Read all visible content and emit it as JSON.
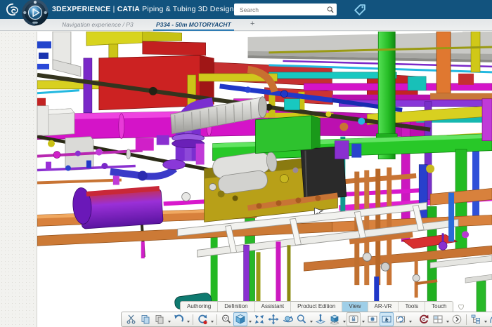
{
  "header": {
    "brand": "3DEXPERIENCE",
    "divider": "|",
    "app_name": "CATIA",
    "app_suffix": "Piping & Tubing 3D Design",
    "search_placeholder": "Search"
  },
  "nav": {
    "breadcrumb": "Navigation experience / P3",
    "active_document_tab": "P334 - 50m MOTORYACHT",
    "new_tab_label": "+"
  },
  "action_bar": {
    "tabs": [
      {
        "name": "authoring",
        "label": "Authoring",
        "active": false
      },
      {
        "name": "definition",
        "label": "Definition",
        "active": false
      },
      {
        "name": "assistant",
        "label": "Assistant",
        "active": false
      },
      {
        "name": "product-edition",
        "label": "Product Edition",
        "active": false
      },
      {
        "name": "view",
        "label": "View",
        "active": true
      },
      {
        "name": "ar-vr",
        "label": "AR-VR",
        "active": false
      },
      {
        "name": "tools",
        "label": "Tools",
        "active": false
      },
      {
        "name": "touch",
        "label": "Touch",
        "active": false
      }
    ]
  },
  "toolbar": {
    "icons": [
      {
        "name": "cut",
        "icon": "cut",
        "dropdown": false
      },
      {
        "name": "copy",
        "icon": "copy",
        "dropdown": false
      },
      {
        "name": "paste",
        "icon": "paste",
        "dropdown": true
      },
      {
        "name": "undo",
        "icon": "undo",
        "dropdown": true
      },
      {
        "name": "update",
        "icon": "update",
        "dropdown": true,
        "sep_before": true
      },
      {
        "name": "look-at",
        "icon": "lookat",
        "dropdown": false,
        "sep_before": true
      },
      {
        "name": "iso-view",
        "icon": "cube",
        "dropdown": true,
        "active": true
      },
      {
        "name": "fit-all-in",
        "icon": "fit",
        "dropdown": false
      },
      {
        "name": "pan",
        "icon": "pan",
        "dropdown": false
      },
      {
        "name": "rotate",
        "icon": "rotate",
        "dropdown": false
      },
      {
        "name": "zoom",
        "icon": "zoom",
        "dropdown": true
      },
      {
        "name": "normal-view",
        "icon": "normalto",
        "dropdown": false
      },
      {
        "name": "named-views",
        "icon": "views",
        "dropdown": true
      },
      {
        "name": "screen-lock",
        "icon": "screenlock",
        "dropdown": true,
        "boxed": true
      },
      {
        "name": "screen-settings",
        "icon": "screengear",
        "dropdown": false
      },
      {
        "name": "screen-select",
        "icon": "screencursor",
        "dropdown": false,
        "active": true
      },
      {
        "name": "screen-rotate",
        "icon": "screenrotate",
        "dropdown": true
      },
      {
        "name": "update-visualization",
        "icon": "refreshred",
        "dropdown": false,
        "gap_before": true
      },
      {
        "name": "window-layout",
        "icon": "grid",
        "dropdown": true
      },
      {
        "name": "more-commands",
        "icon": "more",
        "dropdown": false
      },
      {
        "name": "design-tree",
        "icon": "tree",
        "dropdown": true,
        "sep_before": true
      },
      {
        "name": "3d-navigation",
        "icon": "nav3d",
        "dropdown": true
      }
    ]
  },
  "colors": {
    "topbar": "#12537e",
    "tab_underline": "#2f7cb4",
    "ribbon_active_tab": "#9fcfe8"
  }
}
